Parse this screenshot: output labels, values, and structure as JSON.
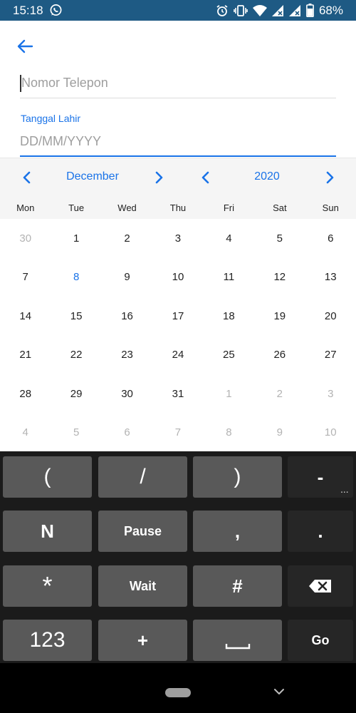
{
  "status_bar": {
    "time": "15:18",
    "battery": "68%",
    "icons": [
      "whatsapp-icon",
      "alarm-icon",
      "vibrate-icon",
      "wifi-icon",
      "signal-icon",
      "signal-icon",
      "battery-icon"
    ]
  },
  "form": {
    "phone_placeholder": "Nomor Telepon",
    "dob_label": "Tanggal Lahir",
    "dob_placeholder": "DD/MM/YYYY"
  },
  "calendar": {
    "month": "December",
    "year": "2020",
    "weekdays": [
      "Mon",
      "Tue",
      "Wed",
      "Thu",
      "Fri",
      "Sat",
      "Sun"
    ],
    "weeks": [
      [
        {
          "d": "30",
          "muted": true
        },
        {
          "d": "1"
        },
        {
          "d": "2"
        },
        {
          "d": "3"
        },
        {
          "d": "4"
        },
        {
          "d": "5"
        },
        {
          "d": "6"
        }
      ],
      [
        {
          "d": "7"
        },
        {
          "d": "8",
          "today": true
        },
        {
          "d": "9"
        },
        {
          "d": "10"
        },
        {
          "d": "11"
        },
        {
          "d": "12"
        },
        {
          "d": "13"
        }
      ],
      [
        {
          "d": "14"
        },
        {
          "d": "15"
        },
        {
          "d": "16"
        },
        {
          "d": "17"
        },
        {
          "d": "18"
        },
        {
          "d": "19"
        },
        {
          "d": "20"
        }
      ],
      [
        {
          "d": "21"
        },
        {
          "d": "22"
        },
        {
          "d": "23"
        },
        {
          "d": "24"
        },
        {
          "d": "25"
        },
        {
          "d": "26"
        },
        {
          "d": "27"
        }
      ],
      [
        {
          "d": "28"
        },
        {
          "d": "29"
        },
        {
          "d": "30"
        },
        {
          "d": "31"
        },
        {
          "d": "1",
          "muted": true
        },
        {
          "d": "2",
          "muted": true
        },
        {
          "d": "3",
          "muted": true
        }
      ],
      [
        {
          "d": "4",
          "muted": true
        },
        {
          "d": "5",
          "muted": true
        },
        {
          "d": "6",
          "muted": true
        },
        {
          "d": "7",
          "muted": true
        },
        {
          "d": "8",
          "muted": true
        },
        {
          "d": "9",
          "muted": true
        },
        {
          "d": "10",
          "muted": true
        }
      ]
    ]
  },
  "keyboard": {
    "row1": [
      "(",
      "/",
      ")",
      "-"
    ],
    "row2": [
      "N",
      "Pause",
      ",",
      "."
    ],
    "row3": [
      "*",
      "Wait",
      "#",
      "backspace"
    ],
    "row4": [
      "123",
      "+",
      "space",
      "Go"
    ],
    "dash_more": "..."
  },
  "colors": {
    "status_bar": "#1e5a84",
    "accent": "#1a73e8",
    "calendar_header": "#f5f5f5",
    "keyboard_bg": "#1b1b1b",
    "key_light": "#595959",
    "key_dark": "#262626"
  }
}
